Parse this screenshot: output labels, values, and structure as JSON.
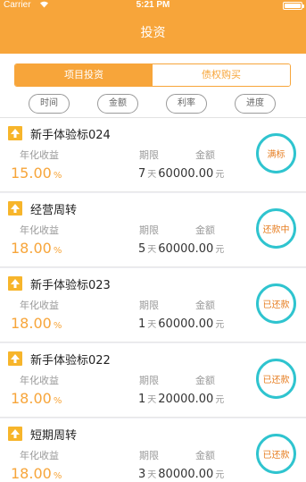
{
  "status_bar": {
    "carrier": "Carrier",
    "wifi": "wifi-icon",
    "time": "5:21 PM",
    "battery": "battery-icon"
  },
  "nav": {
    "title": "投资"
  },
  "tabs": [
    {
      "label": "项目投资",
      "active": true
    },
    {
      "label": "债权购买",
      "active": false
    }
  ],
  "filters": [
    "时间",
    "金额",
    "利率",
    "进度"
  ],
  "labels": {
    "rate": "年化收益",
    "term": "期限",
    "amount": "金额",
    "percent_unit": "%",
    "day_unit": "天",
    "yuan_unit": "元"
  },
  "items": [
    {
      "icon": "arrow-up-icon",
      "name": "新手体验标024",
      "rate": "15.00",
      "term": "7",
      "amount": "60000.00",
      "status": "满标"
    },
    {
      "icon": "arrow-up-icon",
      "name": "经营周转",
      "rate": "18.00",
      "term": "5",
      "amount": "60000.00",
      "status": "还款中"
    },
    {
      "icon": "arrow-up-icon",
      "name": "新手体验标023",
      "rate": "18.00",
      "term": "1",
      "amount": "60000.00",
      "status": "已还款"
    },
    {
      "icon": "arrow-up-icon",
      "name": "新手体验标022",
      "rate": "18.00",
      "term": "1",
      "amount": "20000.00",
      "status": "已还款"
    },
    {
      "icon": "arrow-up-icon",
      "name": "短期周转",
      "rate": "18.00",
      "term": "3",
      "amount": "80000.00",
      "status": "已还款"
    }
  ],
  "colors": {
    "accent": "#f7a53a",
    "badge_ring": "#2fc4cf",
    "badge_text": "#e67e22"
  }
}
